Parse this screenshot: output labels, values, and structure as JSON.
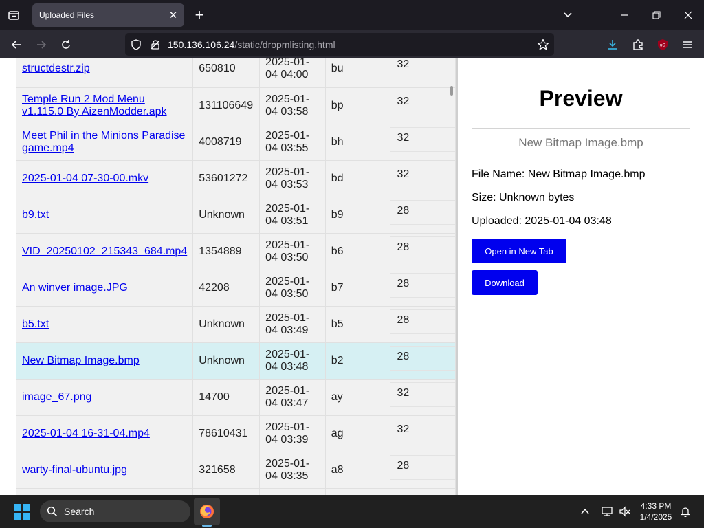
{
  "browser": {
    "tab_title": "Uploaded Files",
    "url_host": "150.136.106.24",
    "url_path": "/static/dropmlisting.html"
  },
  "files": [
    {
      "name": "structdestr.zip",
      "size": "650810",
      "date": "2025-01-04 04:00",
      "code": "bu",
      "num": "32",
      "selected": false
    },
    {
      "name": "Temple Run 2 Mod Menu v1.115.0 By AizenModder.apk",
      "size": "131106649",
      "date": "2025-01-04 03:58",
      "code": "bp",
      "num": "32",
      "selected": false
    },
    {
      "name": "Meet Phil in the Minions Paradise game.mp4",
      "size": "4008719",
      "date": "2025-01-04 03:55",
      "code": "bh",
      "num": "32",
      "selected": false
    },
    {
      "name": "2025-01-04 07-30-00.mkv",
      "size": "53601272",
      "date": "2025-01-04 03:53",
      "code": "bd",
      "num": "32",
      "selected": false
    },
    {
      "name": "b9.txt",
      "size": "Unknown",
      "date": "2025-01-04 03:51",
      "code": "b9",
      "num": "28",
      "selected": false
    },
    {
      "name": "VID_20250102_215343_684.mp4",
      "size": "1354889",
      "date": "2025-01-04 03:50",
      "code": "b6",
      "num": "28",
      "selected": false
    },
    {
      "name": "An winver image.JPG",
      "size": "42208",
      "date": "2025-01-04 03:50",
      "code": "b7",
      "num": "28",
      "selected": false
    },
    {
      "name": "b5.txt",
      "size": "Unknown",
      "date": "2025-01-04 03:49",
      "code": "b5",
      "num": "28",
      "selected": false
    },
    {
      "name": "New Bitmap Image.bmp",
      "size": "Unknown",
      "date": "2025-01-04 03:48",
      "code": "b2",
      "num": "28",
      "selected": true
    },
    {
      "name": "image_67.png",
      "size": "14700",
      "date": "2025-01-04 03:47",
      "code": "ay",
      "num": "32",
      "selected": false
    },
    {
      "name": "2025-01-04 16-31-04.mp4",
      "size": "78610431",
      "date": "2025-01-04 03:39",
      "code": "ag",
      "num": "32",
      "selected": false
    },
    {
      "name": "warty-final-ubuntu.jpg",
      "size": "321658",
      "date": "2025-01-04 03:35",
      "code": "a8",
      "num": "28",
      "selected": false
    },
    {
      "name": "",
      "size": "",
      "date": "",
      "code": "",
      "num": "",
      "selected": false
    }
  ],
  "preview": {
    "title": "Preview",
    "placeholder": "New Bitmap Image.bmp",
    "file_name": "File Name: New Bitmap Image.bmp",
    "size": "Size: Unknown bytes",
    "uploaded": "Uploaded: 2025-01-04 03:48",
    "open_label": "Open in New Tab",
    "download_label": "Download"
  },
  "taskbar": {
    "search_label": "Search",
    "time": "4:33 PM",
    "date": "1/4/2025"
  },
  "colors": {
    "link": "#0000ee",
    "button": "#0000ee",
    "selected_row": "#d6f0f3",
    "row": "#f1f1f1"
  }
}
